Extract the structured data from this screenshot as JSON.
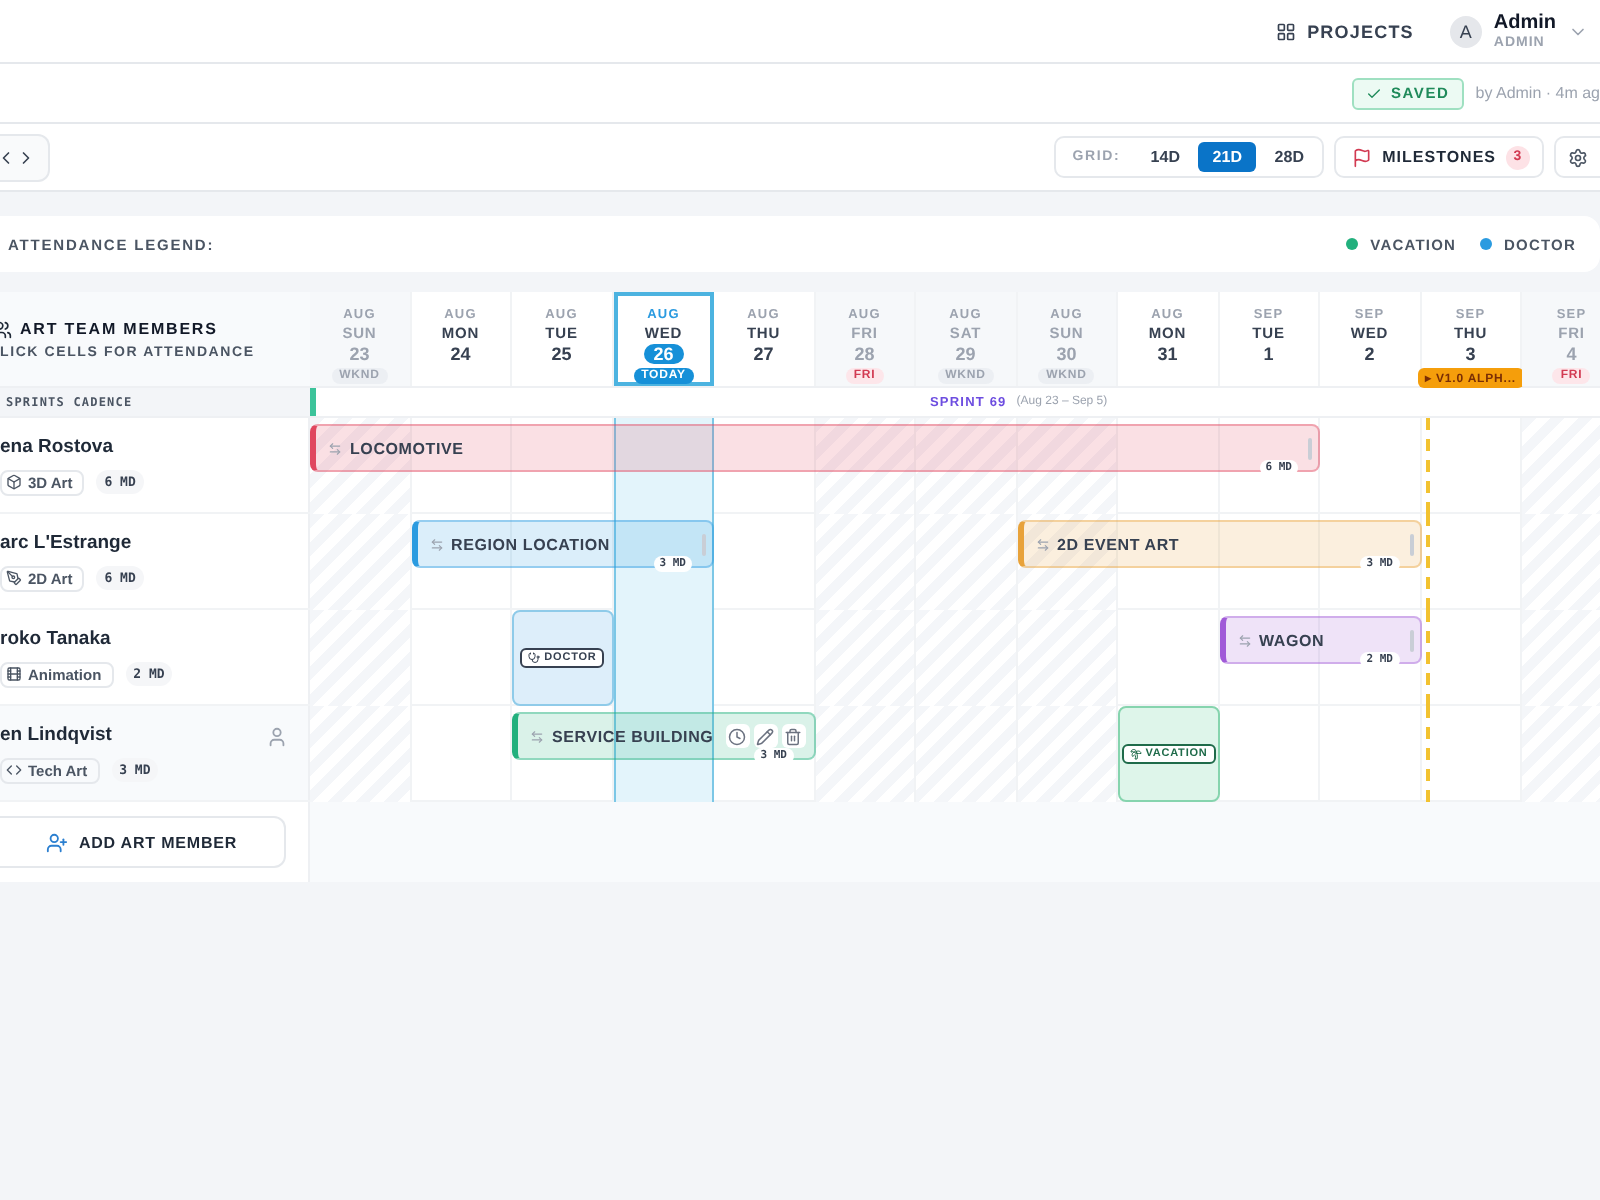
{
  "header": {
    "projects_label": "PROJECTS",
    "user": {
      "initial": "A",
      "name": "Admin",
      "role": "ADMIN"
    }
  },
  "save_status": {
    "badge": "SAVED",
    "meta": "by Admin · 4m ag"
  },
  "toolbar": {
    "grid_label": "GRID:",
    "grid_options": [
      {
        "label": "14D",
        "selected": false
      },
      {
        "label": "21D",
        "selected": true
      },
      {
        "label": "28D",
        "selected": false
      }
    ],
    "milestones": {
      "label": "MILESTONES",
      "count": "3"
    }
  },
  "legend": {
    "title": "ATTENDANCE LEGEND:",
    "items": [
      {
        "label": "VACATION",
        "color": "#22b07d"
      },
      {
        "label": "DOCTOR",
        "color": "#2b9be0"
      }
    ]
  },
  "team": {
    "title": "ART TEAM MEMBERS",
    "subtitle": "LICK CELLS FOR ATTENDANCE",
    "cadence_label": "SPRINTS CADENCE",
    "add_label": "ADD ART MEMBER"
  },
  "days": [
    {
      "month": "AUG",
      "weekday": "SUN",
      "date": "23",
      "kind": "weekend",
      "badge": "WKND"
    },
    {
      "month": "AUG",
      "weekday": "MON",
      "date": "24",
      "kind": "workday"
    },
    {
      "month": "AUG",
      "weekday": "TUE",
      "date": "25",
      "kind": "workday"
    },
    {
      "month": "AUG",
      "weekday": "WED",
      "date": "26",
      "kind": "today",
      "badge": "TODAY"
    },
    {
      "month": "AUG",
      "weekday": "THU",
      "date": "27",
      "kind": "workday"
    },
    {
      "month": "AUG",
      "weekday": "FRI",
      "date": "28",
      "kind": "holiday",
      "badge": "FRI"
    },
    {
      "month": "AUG",
      "weekday": "SAT",
      "date": "29",
      "kind": "weekend",
      "badge": "WKND"
    },
    {
      "month": "AUG",
      "weekday": "SUN",
      "date": "30",
      "kind": "weekend",
      "badge": "WKND"
    },
    {
      "month": "AUG",
      "weekday": "MON",
      "date": "31",
      "kind": "workday"
    },
    {
      "month": "SEP",
      "weekday": "TUE",
      "date": "1",
      "kind": "workday"
    },
    {
      "month": "SEP",
      "weekday": "WED",
      "date": "2",
      "kind": "workday"
    },
    {
      "month": "SEP",
      "weekday": "THU",
      "date": "3",
      "kind": "milestone",
      "badge": "▸ V1.0 ALPH..."
    },
    {
      "month": "SEP",
      "weekday": "FRI",
      "date": "4",
      "kind": "holiday",
      "badge": "FRI"
    }
  ],
  "sprint": {
    "name": "SPRINT 69",
    "range": "(Aug 23 – Sep 5)"
  },
  "members": [
    {
      "name": "ena Rostova",
      "discipline": "3D Art",
      "md": "6 MD",
      "hovered": false,
      "timeline": [
        {
          "kind": "task",
          "title": "LOCOMOTIVE",
          "color": "#e0475f",
          "md": "6 MD",
          "hovered": false
        },
        {
          "kind": "cont"
        },
        {
          "kind": "cont"
        },
        {
          "kind": "cont"
        },
        {
          "kind": "cont"
        },
        {
          "kind": "cont"
        },
        {
          "kind": "cont"
        },
        {
          "kind": "cont"
        },
        {
          "kind": "cont"
        },
        {
          "kind": "cont"
        },
        {
          "kind": "free"
        },
        {
          "kind": "free"
        },
        {
          "kind": "free"
        }
      ]
    },
    {
      "name": "arc L'Estrange",
      "discipline": "2D Art",
      "md": "6 MD",
      "hovered": false,
      "timeline": [
        {
          "kind": "free"
        },
        {
          "kind": "task",
          "title": "REGION LOCATION",
          "color": "#2b9be0",
          "md": "3 MD",
          "hovered": false
        },
        {
          "kind": "cont"
        },
        {
          "kind": "cont"
        },
        {
          "kind": "free"
        },
        {
          "kind": "free"
        },
        {
          "kind": "free"
        },
        {
          "kind": "task",
          "title": "2D EVENT ART",
          "color": "#e8a23a",
          "md": "3 MD",
          "hovered": false
        },
        {
          "kind": "cont"
        },
        {
          "kind": "cont"
        },
        {
          "kind": "cont"
        },
        {
          "kind": "free"
        },
        {
          "kind": "free"
        }
      ]
    },
    {
      "name": "roko Tanaka",
      "discipline": "Animation",
      "md": "2 MD",
      "hovered": false,
      "timeline": [
        {
          "kind": "free"
        },
        {
          "kind": "free"
        },
        {
          "kind": "doctor",
          "label": "DOCTOR"
        },
        {
          "kind": "free"
        },
        {
          "kind": "free"
        },
        {
          "kind": "free"
        },
        {
          "kind": "free"
        },
        {
          "kind": "free"
        },
        {
          "kind": "free"
        },
        {
          "kind": "task",
          "title": "WAGON",
          "color": "#a05ad8",
          "md": "2 MD",
          "hovered": false
        },
        {
          "kind": "cont"
        },
        {
          "kind": "free"
        },
        {
          "kind": "free"
        }
      ]
    },
    {
      "name": "en Lindqvist",
      "discipline": "Tech Art",
      "md": "3 MD",
      "hovered": true,
      "timeline": [
        {
          "kind": "free"
        },
        {
          "kind": "free"
        },
        {
          "kind": "task",
          "title": "SERVICE BUILDING",
          "color": "#22b07d",
          "md": "3 MD",
          "hovered": true
        },
        {
          "kind": "cont"
        },
        {
          "kind": "cont"
        },
        {
          "kind": "free"
        },
        {
          "kind": "free"
        },
        {
          "kind": "free"
        },
        {
          "kind": "vacation",
          "label": "VACATION"
        },
        {
          "kind": "free"
        },
        {
          "kind": "free"
        },
        {
          "kind": "free"
        },
        {
          "kind": "free"
        }
      ]
    }
  ]
}
